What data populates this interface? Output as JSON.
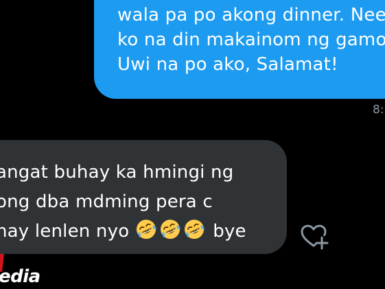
{
  "conversation": {
    "sent_message": {
      "lines": [
        "wala pa po akong dinner. Nee",
        "ko na din makainom ng gamo",
        "Uwi na po ako, Salamat!"
      ],
      "timestamp": "8:",
      "bubble_color": "#1d9bf0"
    },
    "received_message": {
      "lines": [
        "angat buhay ka hmingi ng",
        "ong dba mdming pera c",
        "nay lenlen nyo"
      ],
      "emoji": [
        "rolling-on-floor-laughing-emoji",
        "rolling-on-floor-laughing-emoji",
        "rolling-on-floor-laughing-emoji"
      ],
      "trailing_text": "bye",
      "bubble_color": "#2f3336"
    },
    "react_button_icon": "heart-plus-icon"
  },
  "watermark": {
    "text": "edia"
  },
  "colors": {
    "background": "#000000",
    "timestamp": "#8b98a5",
    "icon": "#8b98a5"
  }
}
